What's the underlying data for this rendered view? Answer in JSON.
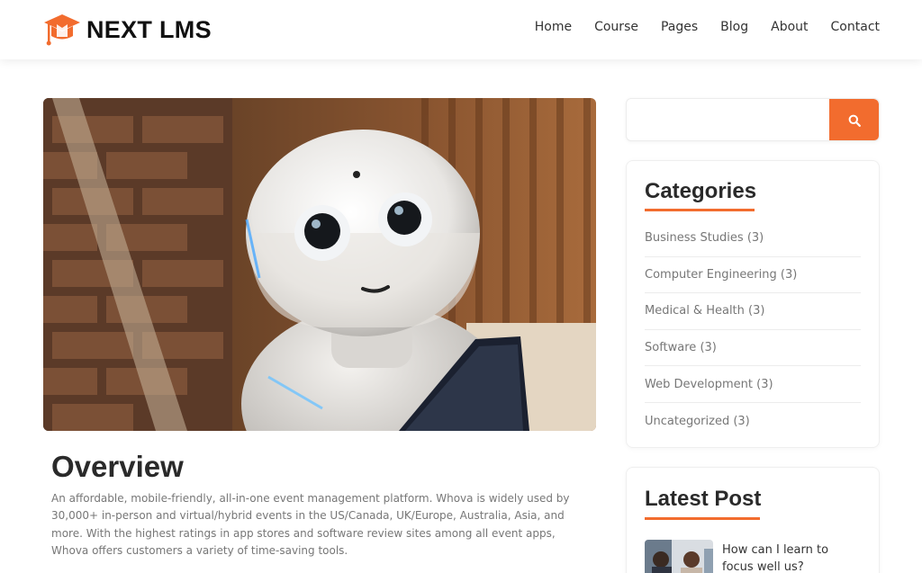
{
  "brand": {
    "name": "NEXT LMS",
    "accent": "#f26c2e"
  },
  "nav": {
    "items": [
      "Home",
      "Course",
      "Pages",
      "Blog",
      "About",
      "Contact"
    ]
  },
  "article": {
    "title": "Overview",
    "body": "An affordable, mobile-friendly, all-in-one event management platform. Whova is widely used by 30,000+ in-person and virtual/hybrid events in the US/Canada, UK/Europe, Australia, Asia, and more. With the highest ratings in app stores and software review sites among all event apps, Whova offers customers a variety of time-saving tools."
  },
  "sidebar": {
    "search": {
      "placeholder": "",
      "icon": "search-icon"
    },
    "categories": {
      "title": "Categories",
      "items": [
        "Business Studies (3)",
        "Computer Engineering (3)",
        "Medical & Health (3)",
        "Software (3)",
        "Web Development (3)",
        "Uncategorized (3)"
      ]
    },
    "latest": {
      "title": "Latest Post",
      "posts": [
        {
          "title": "How can I learn to focus well us?"
        }
      ]
    }
  }
}
